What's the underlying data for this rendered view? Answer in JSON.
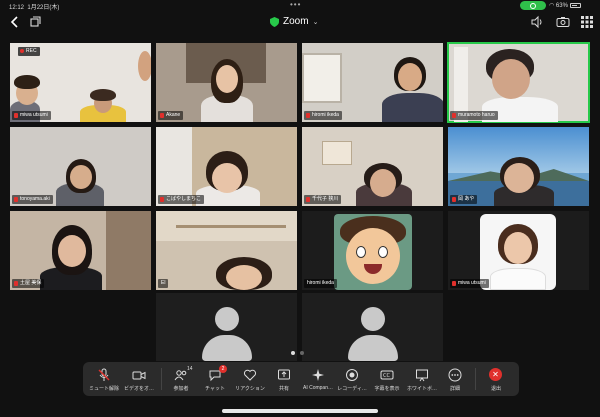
{
  "status_bar": {
    "time": "12:12",
    "date": "1月22日(木)",
    "battery": "63%"
  },
  "header": {
    "title": "Zoom",
    "recording_label": "REC"
  },
  "participants": [
    {
      "name": "miwa utsumi",
      "mic_muted": true
    },
    {
      "name": "Akane",
      "mic_muted": true
    },
    {
      "name": "hiromi ikeda",
      "mic_muted": true
    },
    {
      "name": "muramoto haruo",
      "mic_muted": true
    },
    {
      "name": "tonoyama.aki",
      "mic_muted": true
    },
    {
      "name": "こばやしまちこ",
      "mic_muted": true
    },
    {
      "name": "千代子 狭川",
      "mic_muted": true
    },
    {
      "name": "岡 あや",
      "mic_muted": true
    },
    {
      "name": "土屋 美保",
      "mic_muted": true
    },
    {
      "name": "El",
      "mic_muted": false
    },
    {
      "name": "hiromi ikeda",
      "mic_muted": false
    },
    {
      "name": "miwa utsumi",
      "mic_muted": true
    }
  ],
  "toolbar": {
    "mute": "ミュート解除",
    "video": "ビデオをオ…",
    "participants": "参加者",
    "participants_count": "14",
    "chat": "チャット",
    "chat_badge": "2",
    "reactions": "リアクション",
    "share": "共有",
    "ai": "AI Compan…",
    "record": "レコーディ…",
    "captions": "字幕を表示",
    "whiteboard": "ホワイトボ…",
    "more": "詳細",
    "leave": "退出"
  },
  "colors": {
    "active_speaker": "#27c94a",
    "danger": "#e0302c",
    "toolbar_bg": "#2b2b2b"
  }
}
